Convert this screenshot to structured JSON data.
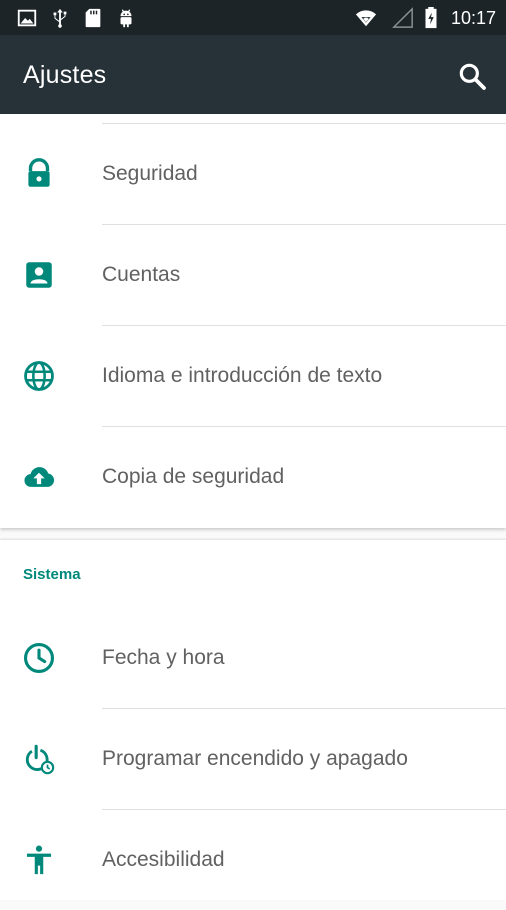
{
  "status_bar": {
    "time": "10:17",
    "left_icons": [
      "image-icon",
      "usb-icon",
      "sd-card-icon",
      "android-icon"
    ],
    "right_icons": [
      "wifi-icon",
      "signal-icon",
      "battery-icon"
    ]
  },
  "app_bar": {
    "title": "Ajustes",
    "search_icon": "search-icon"
  },
  "colors": {
    "accent": "#00897b",
    "app_bar": "#263238",
    "status_bar": "#1c2428",
    "label_text": "#616161",
    "divider": "#e0e0e0"
  },
  "personal_items": [
    {
      "label": "Seguridad",
      "icon": "lock-icon"
    },
    {
      "label": "Cuentas",
      "icon": "account-icon"
    },
    {
      "label": "Idioma e introducción de texto",
      "icon": "globe-icon"
    },
    {
      "label": "Copia de seguridad",
      "icon": "cloud-upload-icon"
    }
  ],
  "system_section": {
    "header": "Sistema",
    "items": [
      {
        "label": "Fecha y hora",
        "icon": "clock-icon"
      },
      {
        "label": "Programar encendido y apagado",
        "icon": "power-schedule-icon"
      },
      {
        "label": "Accesibilidad",
        "icon": "accessibility-icon"
      }
    ]
  }
}
